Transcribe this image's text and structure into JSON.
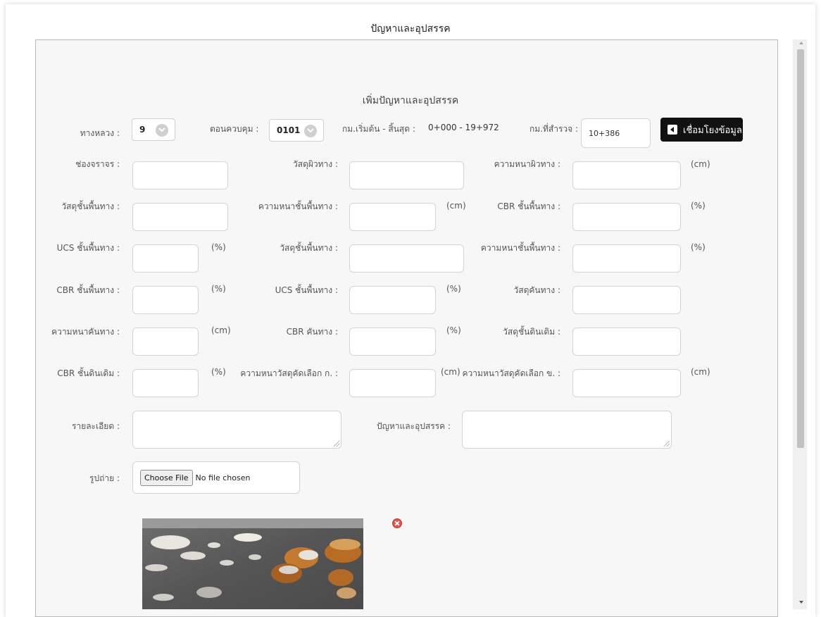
{
  "header": {
    "title": "ปัญหาและอุปสรรค"
  },
  "form": {
    "title": "เพิ่มปัญหาและอุปสรรค",
    "highway_label": "ทางหลวง :",
    "highway_value": "9",
    "control_label": "ตอนควบคุม :",
    "control_value": "0101",
    "km_range_label": "กม.เริ่มต้น - สิ้นสุด :",
    "km_range_value": "0+000 - 19+972",
    "survey_km_label": "กม.ที่สำรวจ :",
    "survey_km_value": "10+386",
    "link_button": "เชื่อมโยงข้อมูล",
    "lane_label": "ช่องจราจร :",
    "surface_material_label": "วัสดุผิวทาง :",
    "surface_thickness_label": "ความหนาผิวทาง :",
    "base_material_label": "วัสดุชั้นพื้นทาง :",
    "base_thickness_label": "ความหนาชั้นพื้นทาง :",
    "base_cbr_label": "CBR ชั้นพื้นทาง :",
    "base_ucs_label": "UCS ชั้นพื้นทาง :",
    "subbase_material_label": "วัสดุชั้นพื้นทาง :",
    "subbase_thickness_label": "ความหนาชั้นพื้นทาง :",
    "subbase_cbr_label": "CBR ชั้นพื้นทาง :",
    "subbase_ucs_label": "UCS ชั้นพื้นทาง :",
    "shoulder_material_label": "วัสดุคันทาง :",
    "shoulder_thickness_label": "ความหนาคันทาง :",
    "shoulder_cbr_label": "CBR คันทาง :",
    "subgrade_material_label": "วัสดุชั้นดินเดิม :",
    "subgrade_cbr_label": "CBR ชั้นดินเดิม :",
    "selected_a_label": "ความหนาวัสดุคัดเลือก ก. :",
    "selected_b_label": "ความหนาวัสดุคัดเลือก ข. :",
    "details_label": "รายละเอียด :",
    "problems_label": "ปัญหาและอุปสรรค :",
    "photo_label": "รูปถ่าย :",
    "choose_file": "Choose File",
    "no_file": "No file chosen",
    "unit_cm": "(cm)",
    "unit_pct": "(%)"
  },
  "icons": {
    "select_chevron": "chevron-down-icon",
    "link": "back-arrow-icon",
    "delete": "delete-icon"
  },
  "colors": {
    "link_button_bg": "#111111",
    "delete_icon": "#e0524a"
  }
}
